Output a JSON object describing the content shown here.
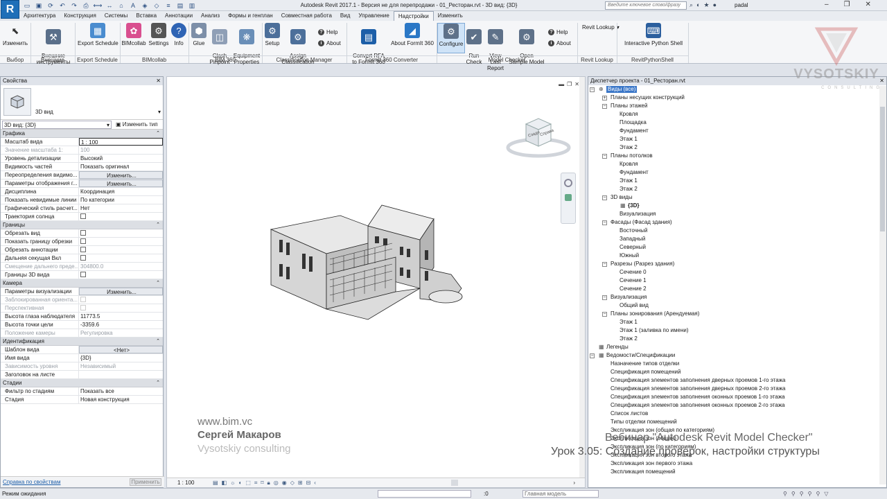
{
  "app": {
    "logo_letter": "R",
    "title": "Autodesk Revit 2017.1 - Версия не для перепродажи -    01_Ресторан.rvt - 3D вид: {3D}",
    "search_placeholder": "Введите ключевое слово/фразу",
    "user": "padal"
  },
  "tabs": [
    "Архитектура",
    "Конструкция",
    "Системы",
    "Вставка",
    "Аннотации",
    "Анализ",
    "Формы и генплан",
    "Совместная работа",
    "Вид",
    "Управление",
    "Надстройки",
    "Изменить"
  ],
  "active_tab": "Надстройки",
  "ribbon": {
    "buttons": {
      "modify": "Изменить",
      "external_tools": "Внешние\nинструменты",
      "export_schedule": "Export Schedule",
      "bimcollab": "BIMcollab",
      "settings": "Settings",
      "info": "Info",
      "glue": "Glue",
      "clash_pinpoint": "Clash\nPinpoint",
      "equipment_properties": "Equipment\nProperties",
      "setup": "Setup",
      "assign_classification": "Assign\nClassification",
      "convert_rfa": "Convert RFA\nto FormIt 360",
      "about_formit": "About FormIt 360",
      "configure": "Configure",
      "run_check": "Run\nCheck",
      "view_last_report": "View Last\nReport",
      "open_sample_model": "Open\nSample Model",
      "revit_lookup": "Revit Lookup",
      "python_shell": "Interactive Python Shell"
    },
    "help": "Help",
    "about": "About",
    "panels": [
      "Выбор",
      "Внешние",
      "Export Schedule",
      "BIMcollab",
      "BIM 360",
      "Classification Manager",
      "FormIt 360 Converter",
      "Model Checker",
      "Revit Lookup",
      "RevitPythonShell"
    ]
  },
  "properties": {
    "title": "Свойства",
    "type_name": "3D вид",
    "instance": "3D вид: {3D}",
    "edit_type": "Изменить тип",
    "groups": {
      "graphics": "Графика",
      "extents": "Границы",
      "camera": "Камера",
      "identity": "Идентификация",
      "phasing": "Стадии"
    },
    "rows": {
      "scale": [
        "Масштаб вида",
        "1 : 100"
      ],
      "scale_value": [
        "Значение масштаба    1:",
        "100"
      ],
      "detail_level": [
        "Уровень детализации",
        "Высокий"
      ],
      "parts_visibility": [
        "Видимость частей",
        "Показать оригинал"
      ],
      "vg_overrides": [
        "Переопределения видимо...",
        "Изменить..."
      ],
      "graphic_display": [
        "Параметры отображения г...",
        "Изменить..."
      ],
      "discipline": [
        "Дисциплина",
        "Координация"
      ],
      "hidden_lines": [
        "Показать невидимые линии",
        "По категории"
      ],
      "default_style": [
        "Графический стиль расчет...",
        "Нет"
      ],
      "sun_path": [
        "Траектория солнца",
        ""
      ],
      "crop_view": [
        "Обрезать вид",
        ""
      ],
      "crop_visible": [
        "Показать границу обрезки",
        ""
      ],
      "annotation_crop": [
        "Обрезать аннотации",
        ""
      ],
      "far_clip": [
        "Дальняя секущая Вкл",
        ""
      ],
      "far_clip_offset": [
        "Смещение дальнего преде...",
        "304800.0"
      ],
      "section_box": [
        "Границы 3D вида",
        ""
      ],
      "render_settings": [
        "Параметры визуализации",
        "Изменить..."
      ],
      "locked_orientation": [
        "Заблокированная ориента...",
        ""
      ],
      "perspective": [
        "Перспективная",
        ""
      ],
      "eye_elevation": [
        "Высота глаза наблюдателя",
        "11773.5"
      ],
      "target_elevation": [
        "Высота точки цели",
        "-3359.6"
      ],
      "camera_position": [
        "Положение камеры",
        "Регулировка"
      ],
      "view_template": [
        "Шаблон вида",
        "<Нет>"
      ],
      "view_name": [
        "Имя вида",
        "{3D}"
      ],
      "dependency": [
        "Зависимость уровня",
        "Независимый"
      ],
      "title_on_sheet": [
        "Заголовок на листе",
        ""
      ],
      "phase_filter": [
        "Фильтр по стадиям",
        "Показать все"
      ],
      "phase": [
        "Стадия",
        "Новая конструкция"
      ]
    },
    "help_link": "Справка по свойствам",
    "apply": "Применить"
  },
  "viewport": {
    "scale": "1 : 100",
    "viewcube_faces": [
      "Сзади",
      "Справа"
    ]
  },
  "browser": {
    "title": "Диспетчер проекта - 01_Ресторан.rvt",
    "items": [
      "Виды (все)",
      "Планы несущих конструкций",
      "Планы этажей",
      "Кровля",
      "Площадка",
      "Фундамент",
      "Этаж 1",
      "Этаж 2",
      "Планы потолков",
      "Кровля",
      "Фундамент",
      "Этаж 1",
      "Этаж 2",
      "3D виды",
      "{3D}",
      "Визуализация",
      "Фасады (Фасад здания)",
      "Восточный",
      "Западный",
      "Северный",
      "Южный",
      "Разрезы (Разрез здания)",
      "Сечение 0",
      "Сечение 1",
      "Сечение 2",
      "Визуализация",
      "Общий вид",
      "Планы зонирования (Арендуемая)",
      "Этаж 1",
      "Этаж 1 (заливка по имени)",
      "Этаж 2",
      "Легенды",
      "Ведомости/Спецификации",
      "Назначение типов отделки",
      "Спецификация помещений",
      "Спецификация элементов заполнения дверных проемов 1-го этажа",
      "Спецификация элементов заполнения дверных проемов 2-го этажа",
      "Спецификация элементов заполнения оконных проемов 1-го этажа",
      "Спецификация элементов заполнения оконных проемов 2-го этажа",
      "Список листов",
      "Типы отделки помещений",
      "Экспликация зон (общая по категориям)",
      "Экспликация зон (общая)",
      "Экспликация зон (по категориям)",
      "Экспликация зон второго этажа",
      "Экспликация зон первого этажа",
      "Экспликация помещений"
    ]
  },
  "status": {
    "text": "Режим ожидания",
    "value": ":0",
    "model": "Главная модель"
  },
  "watermark": {
    "brand": "VYSOTSKIY",
    "brand_sub": "CONSULTING",
    "site": "www.bim.vc",
    "author": "Сергей Макаров",
    "company": "Vysotskiy consulting",
    "course": "Вебинар \"Autodesk Revit Model Checker\"",
    "lesson": "Урок 3.05: Создание проверок, настройки структуры"
  },
  "colors": {
    "accent": "#1f6fb8",
    "selection": "#3b77c8"
  }
}
